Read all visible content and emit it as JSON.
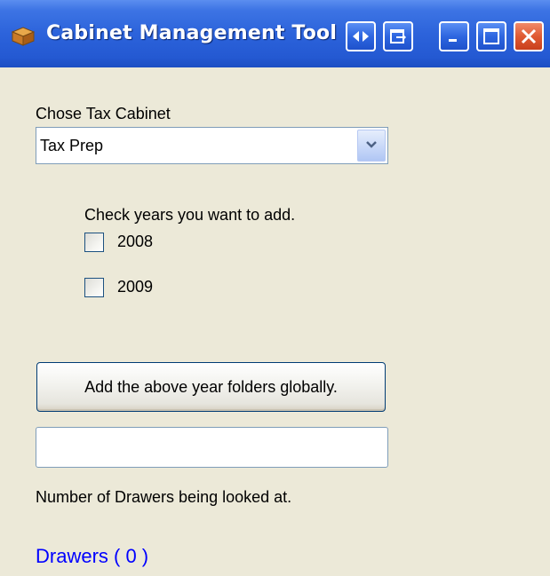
{
  "window": {
    "title": "Cabinet Management Tool",
    "icons": {
      "app": "cabinet-box-icon",
      "resize": "left-right-arrows-icon",
      "exit": "exit-arrow-icon",
      "minimize": "minimize-icon",
      "maximize": "maximize-icon",
      "close": "close-icon"
    }
  },
  "cabinet": {
    "label": "Chose Tax Cabinet",
    "selected": "Tax Prep"
  },
  "years": {
    "prompt": "Check years you want to add.",
    "options": [
      {
        "label": "2008",
        "checked": false
      },
      {
        "label": "2009",
        "checked": false
      }
    ]
  },
  "actions": {
    "add_button_label": "Add the above year folders globally.",
    "output_value": ""
  },
  "drawers": {
    "caption": "Number of Drawers being looked at.",
    "link_label": "Drawers ( 0 )"
  },
  "colors": {
    "titlebar": "#2c63db",
    "window_bg": "#ece9d8",
    "close_button": "#e05a33",
    "link": "#0000ff"
  }
}
